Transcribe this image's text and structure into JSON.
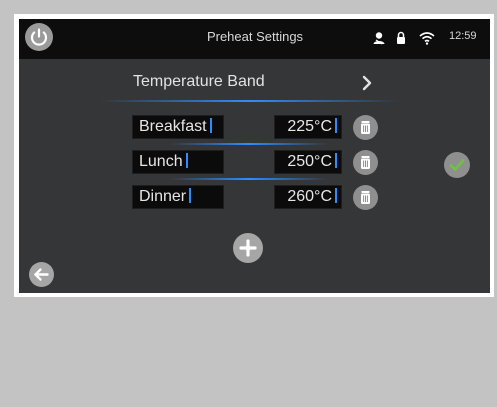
{
  "header": {
    "title": "Preheat Settings",
    "time": "12:59"
  },
  "band": {
    "label": "Temperature Band"
  },
  "rows": [
    {
      "name": "Breakfast",
      "temp": "225°C"
    },
    {
      "name": "Lunch",
      "temp": "250°C"
    },
    {
      "name": "Dinner",
      "temp": "260°C"
    }
  ],
  "icons": {
    "power": "power-icon",
    "user": "user-icon",
    "lock": "lock-icon",
    "wifi": "wifi-icon",
    "chevron": "chevron-right-icon",
    "trash": "trash-icon",
    "confirm": "checkmark-icon",
    "add": "plus-icon",
    "back": "arrow-left-icon"
  },
  "colors": {
    "screen_bg": "#353637",
    "topbar_bg": "#0d0d0d",
    "accent_blue": "#2f8cff",
    "confirm_green": "#6ec33f"
  }
}
